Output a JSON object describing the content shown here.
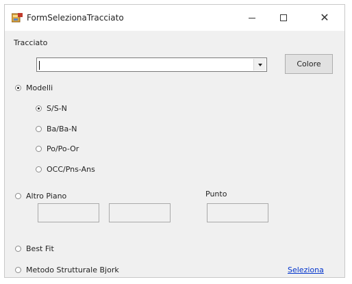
{
  "window": {
    "title": "FormSelezionaTracciato",
    "minimize_glyph": "—",
    "maximize_glyph": "☐",
    "close_glyph": "✕"
  },
  "form": {
    "tracciato_label": "Tracciato",
    "tracciato_value": "",
    "colore_button": "Colore",
    "modelli_label": "Modelli",
    "modelli_selected": true,
    "model_options": [
      {
        "label": "S/S-N",
        "checked": true
      },
      {
        "label": "Ba/Ba-N",
        "checked": false
      },
      {
        "label": "Po/Po-Or",
        "checked": false
      },
      {
        "label": "OCC/Pns-Ans",
        "checked": false
      }
    ],
    "altro_piano_label": "Altro Piano",
    "punto_label": "Punto",
    "best_fit_label": "Best Fit",
    "metodo_label": "Metodo Strutturale Bjork",
    "seleziona_link": "Seleziona"
  }
}
